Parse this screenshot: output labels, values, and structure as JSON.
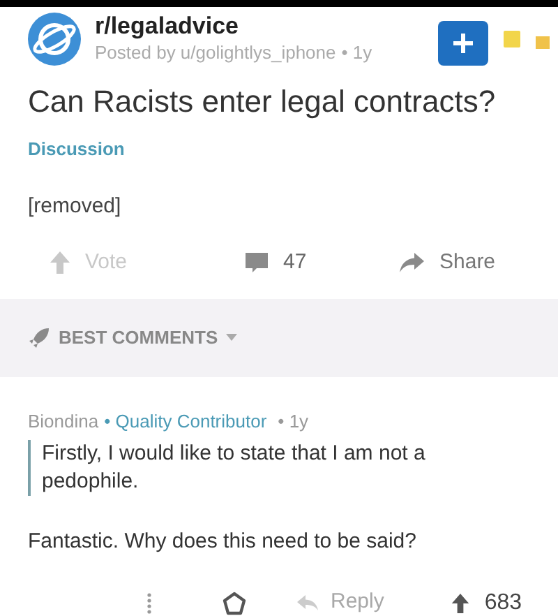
{
  "post": {
    "subreddit": "r/legaladvice",
    "posted_by": "Posted by u/golightlys_iphone",
    "age": "• 1y",
    "title": "Can Racists enter legal contracts?",
    "flair": "Discussion",
    "body": "[removed]"
  },
  "actions": [
    {
      "kind": "vote",
      "label": "Vote"
    },
    {
      "kind": "comments",
      "label": "47"
    },
    {
      "kind": "share",
      "label": "Share"
    }
  ],
  "sort": {
    "label": "BEST COMMENTS"
  },
  "comment": {
    "author": "Biondina",
    "flair": "• Quality Contributor",
    "age": "• 1y",
    "quote": "Firstly, I would like to state that I am not a pedophile.",
    "text": "Fantastic. Why does this need to be said?",
    "reply": "Reply",
    "score": "683"
  }
}
